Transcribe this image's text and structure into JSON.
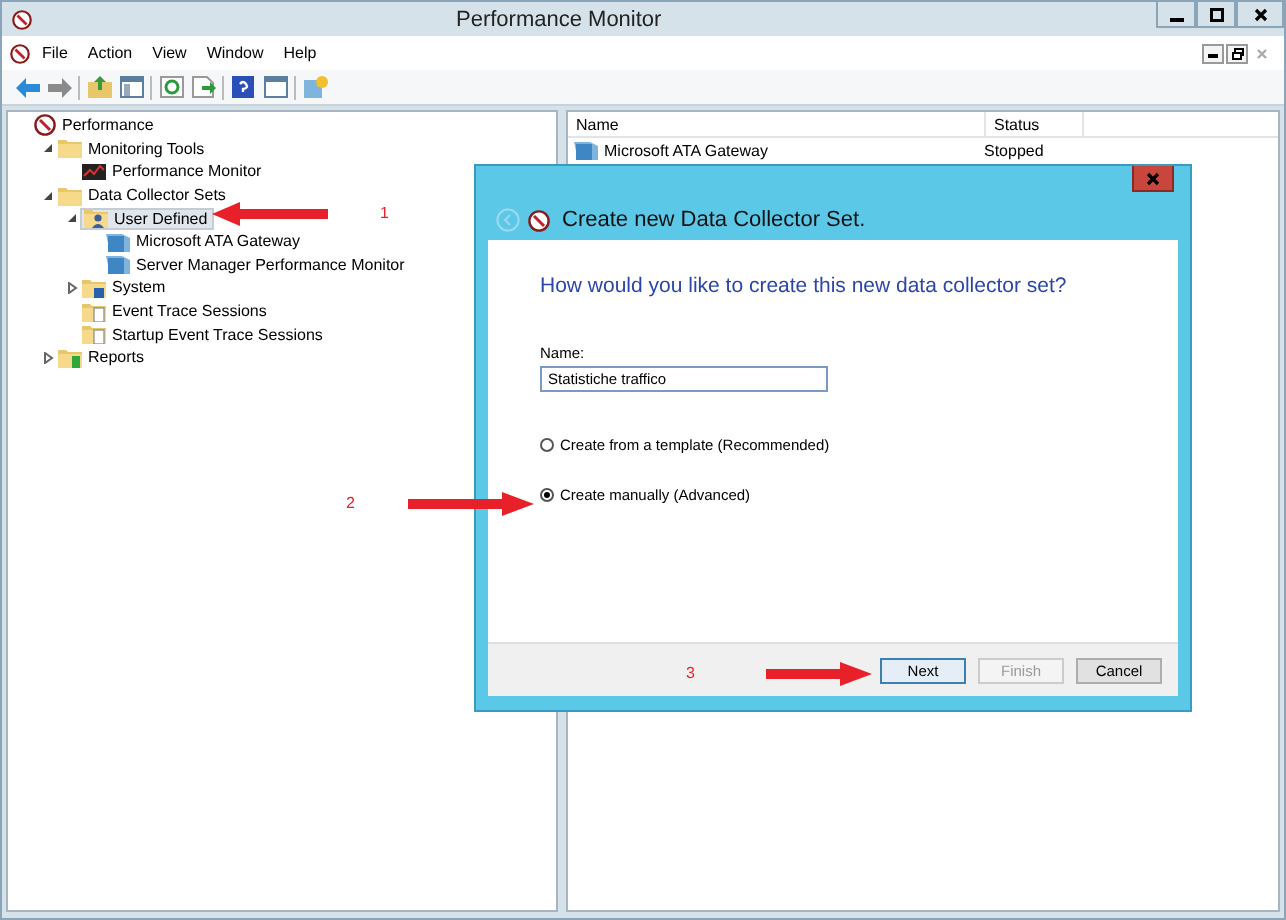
{
  "window": {
    "title": "Performance Monitor"
  },
  "menu": [
    "File",
    "Action",
    "View",
    "Window",
    "Help"
  ],
  "tree": [
    {
      "label": "Performance",
      "kind": "root",
      "selected": false,
      "children": [
        {
          "label": "Monitoring Tools",
          "kind": "folder",
          "expanded": true,
          "selected": false,
          "children": [
            {
              "label": "Performance Monitor",
              "kind": "monitor",
              "selected": false
            }
          ]
        },
        {
          "label": "Data Collector Sets",
          "kind": "folder",
          "expanded": true,
          "selected": false,
          "children": [
            {
              "label": "User Defined",
              "kind": "user-folder",
              "expanded": true,
              "selected": true,
              "children": [
                {
                  "label": "Microsoft ATA Gateway",
                  "kind": "collector",
                  "selected": false
                },
                {
                  "label": "Server Manager Performance Monitor",
                  "kind": "collector",
                  "selected": false
                }
              ]
            },
            {
              "label": "System",
              "kind": "system-folder",
              "expanded": false,
              "selected": false
            },
            {
              "label": "Event Trace Sessions",
              "kind": "doc-folder",
              "selected": false
            },
            {
              "label": "Startup Event Trace Sessions",
              "kind": "doc-folder",
              "selected": false
            }
          ]
        },
        {
          "label": "Reports",
          "kind": "report-folder",
          "expanded": false,
          "selected": false
        }
      ]
    }
  ],
  "list": {
    "columns": [
      "Name",
      "Status"
    ],
    "rows": [
      {
        "name": "Microsoft ATA Gateway",
        "status": "Stopped"
      }
    ]
  },
  "dialog": {
    "title": "Create new Data Collector Set.",
    "question": "How would you like to create this new data collector set?",
    "name_label": "Name:",
    "name_value": "Statistiche traffico",
    "options": [
      {
        "label": "Create from a template (Recommended)",
        "selected": false
      },
      {
        "label": "Create manually (Advanced)",
        "selected": true
      }
    ],
    "buttons": [
      {
        "label": "Next",
        "disabled": false,
        "default": true
      },
      {
        "label": "Finish",
        "disabled": true,
        "default": false
      },
      {
        "label": "Cancel",
        "disabled": false,
        "default": false
      }
    ]
  },
  "annotations": [
    {
      "number": "1"
    },
    {
      "number": "2"
    },
    {
      "number": "3"
    }
  ]
}
